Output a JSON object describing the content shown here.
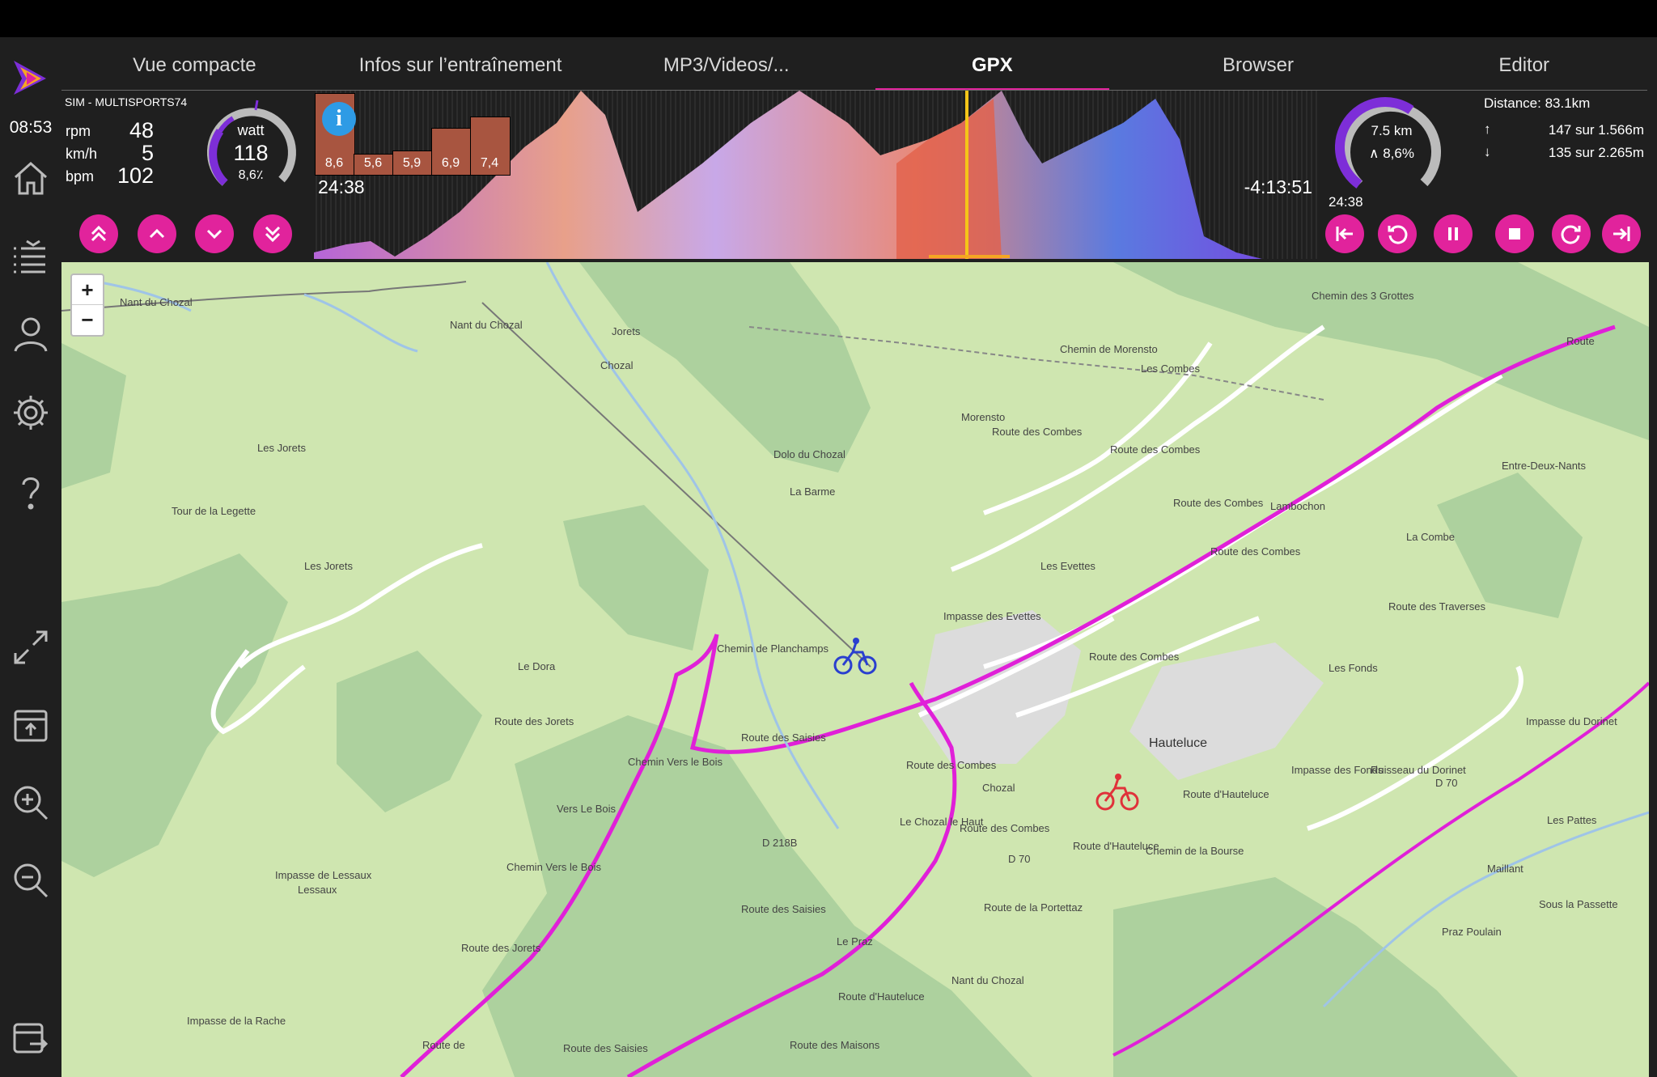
{
  "clock": "08:53",
  "tabs": [
    {
      "label": "Vue compacte"
    },
    {
      "label": "Infos sur l’entraînement"
    },
    {
      "label": "MP3/Videos/..."
    },
    {
      "label": "GPX"
    },
    {
      "label": "Browser"
    },
    {
      "label": "Editor"
    }
  ],
  "active_tab": "GPX",
  "session": {
    "name": "SIM - MULTISPORTS74",
    "rpm_label": "rpm",
    "rpm": "48",
    "kmh_label": "km/h",
    "kmh": "5",
    "bpm_label": "bpm",
    "bpm": "102"
  },
  "power_gauge": {
    "unit": "watt",
    "value": "118",
    "slope": "8,6٪"
  },
  "elevation": {
    "elapsed": "24:38",
    "remaining": "-4:13:51",
    "upcoming_slopes": [
      "8,6",
      "5,6",
      "5,9",
      "6,9",
      "7,4"
    ],
    "info_icon": "info-icon"
  },
  "distance_gauge": {
    "distance": "7.5 km",
    "slope": "∧ 8,6%",
    "time": "24:38"
  },
  "route_stats": {
    "distance": "Distance: 83.1km",
    "up": "147 sur 1.566m",
    "down": "135 sur 2.265m"
  },
  "controls_left": [
    "double-chevron-up-icon",
    "chevron-up-icon",
    "chevron-down-icon",
    "double-chevron-down-icon"
  ],
  "controls_right": [
    "skip-start-icon",
    "rewind-icon",
    "pause-icon",
    "stop-icon",
    "forward-icon",
    "skip-end-icon"
  ],
  "map": {
    "zoom_in": "+",
    "zoom_out": "−",
    "labels": [
      "Nant du Chozal",
      "Nant du Chozal",
      "Jorets",
      "Chozal",
      "Les Jorets",
      "Tour de la Legette",
      "Les Jorets",
      "Le Dora",
      "Route des Jorets",
      "Vers Le Bois",
      "Chemin Vers le Bois",
      "Chemin Vers le Bois",
      "Impasse de Lessaux",
      "Lessaux",
      "Route des Jorets",
      "Impasse de la Rache",
      "Route de",
      "Route des Saisies",
      "Route des Saisies",
      "D 218B",
      "Route des Saisies",
      "Chemin de Planchamps",
      "La Barme",
      "Dolo du Chozal",
      "Morensto",
      "Route des Combes",
      "Chemin de Morensto",
      "Les Combes",
      "Route des Combes",
      "Route des Combes",
      "Lambochon",
      "Les Evettes",
      "Impasse des Evettes",
      "Route des Combes",
      "Route des Combes",
      "Route des Combes",
      "Chozal",
      "Le Chozal le Haut",
      "Route des Combes",
      "D 70",
      "Route d'Hauteluce",
      "Route de la Portettaz",
      "Hauteluce",
      "Route d'Hauteluce",
      "Chemin de la Bourse",
      "Le Praz",
      "Route d'Hauteluce",
      "Route des Maisons",
      "Nant du Chozal",
      "Entre-Deux-Nants",
      "La Combe",
      "Route des Traverses",
      "Les Fonds",
      "Impasse des Fonds",
      "Ruisseau du Dorinet",
      "D 70",
      "Maillant",
      "Les Pattes",
      "Sous la Passette",
      "Praz Poulain",
      "Impasse du Dorinet",
      "Chemin des 3 Grottes",
      "Route"
    ]
  },
  "colors": {
    "accent": "#e1239c",
    "route": "#e020d8",
    "purple": "#7d2ed8",
    "map_bg": "#cfe6b0"
  }
}
